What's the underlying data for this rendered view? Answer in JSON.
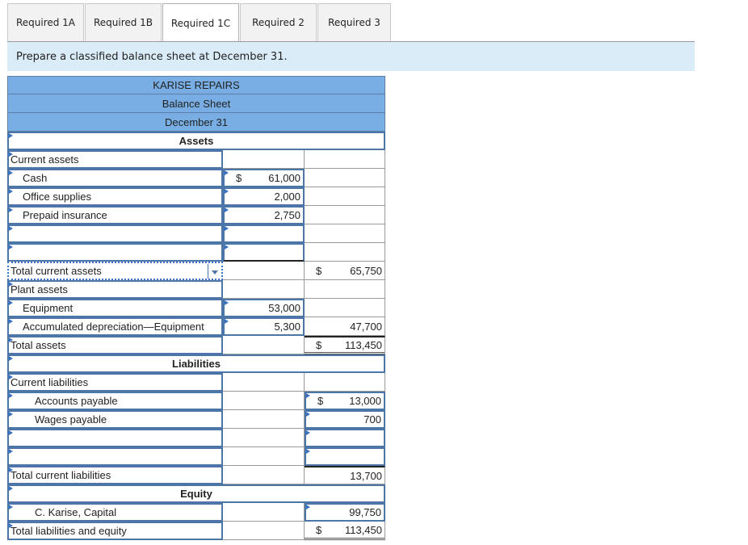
{
  "tabs": [
    {
      "label": "Required 1A",
      "active": false
    },
    {
      "label": "Required 1B",
      "active": false
    },
    {
      "label": "Required 1C",
      "active": true
    },
    {
      "label": "Required 2",
      "active": false
    },
    {
      "label": "Required 3",
      "active": false
    }
  ],
  "instruction": "Prepare a classified balance sheet at December 31.",
  "sheet": {
    "company": "KARISE REPAIRS",
    "title": "Balance Sheet",
    "date": "December 31",
    "sections": {
      "assets": "Assets",
      "liabilities": "Liabilities",
      "equity": "Equity"
    },
    "rows": {
      "current_assets": {
        "label": "Current assets"
      },
      "cash": {
        "label": "Cash",
        "currency": "$",
        "col2": "61,000"
      },
      "office_supplies": {
        "label": "Office supplies",
        "col2": "2,000"
      },
      "prepaid_insurance": {
        "label": "Prepaid insurance",
        "col2": "2,750"
      },
      "blank1": {
        "label": ""
      },
      "blank2": {
        "label": ""
      },
      "total_current_assets": {
        "label": "Total current assets",
        "currency": "$",
        "col3": "65,750"
      },
      "plant_assets": {
        "label": "Plant assets"
      },
      "equipment": {
        "label": "Equipment",
        "col2": "53,000"
      },
      "accum_dep": {
        "label": "Accumulated depreciation—Equipment",
        "col2": "5,300",
        "col3": "47,700"
      },
      "total_assets": {
        "label": "Total assets",
        "currency": "$",
        "col3": "113,450"
      },
      "current_liabilities": {
        "label": "Current liabilities"
      },
      "accounts_payable": {
        "label": "Accounts payable",
        "currency": "$",
        "col3": "13,000"
      },
      "wages_payable": {
        "label": "Wages payable",
        "col3": "700"
      },
      "blank3": {
        "label": ""
      },
      "blank4": {
        "label": ""
      },
      "total_current_liabilities": {
        "label": "Total current liabilities",
        "col3": "13,700"
      },
      "capital": {
        "label": "C. Karise, Capital",
        "col3": "99,750"
      },
      "total_liab_equity": {
        "label": "Total liabilities and equity",
        "currency": "$",
        "col3": "113,450"
      }
    }
  }
}
